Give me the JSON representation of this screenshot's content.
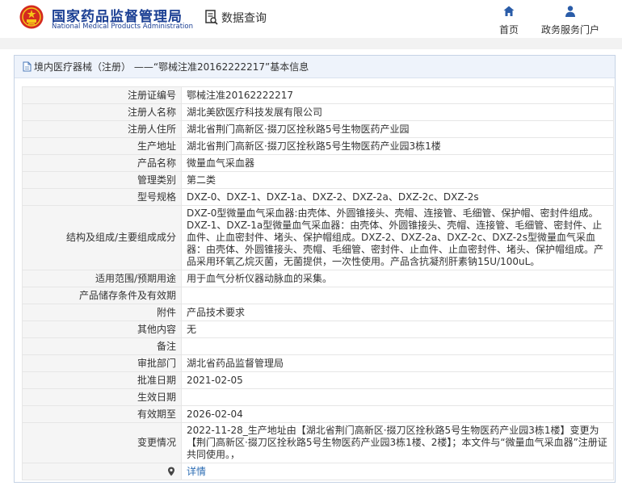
{
  "header": {
    "brand_cn": "国家药品监督管理局",
    "brand_en": "National Medical Products Administration",
    "search_label": "数据查询",
    "nav": [
      {
        "label": "首页",
        "icon": "home-icon"
      },
      {
        "label": "政务服务门户",
        "icon": "user-icon"
      }
    ]
  },
  "panel": {
    "title": "境内医疗器械（注册） ——“鄂械注准20162222217”基本信息"
  },
  "rows": [
    {
      "key": "注册证编号",
      "value": "鄂械注准20162222217"
    },
    {
      "key": "注册人名称",
      "value": "湖北美欧医疗科技发展有限公司"
    },
    {
      "key": "注册人住所",
      "value": "湖北省荆门高新区·掇刀区拴秋路5号生物医药产业园"
    },
    {
      "key": "生产地址",
      "value": "湖北省荆门高新区·掇刀区拴秋路5号生物医药产业园3栋1楼"
    },
    {
      "key": "产品名称",
      "value": "微量血气采血器"
    },
    {
      "key": "管理类别",
      "value": "第二类"
    },
    {
      "key": "型号规格",
      "value": "DXZ-0、DXZ-1、DXZ-1a、DXZ-2、DXZ-2a、DXZ-2c、DXZ-2s"
    },
    {
      "key": "结构及组成/主要组成成分",
      "value": "DXZ-0型微量血气采血器:由壳体、外圆锥接头、壳帽、连接管、毛细管、保护帽、密封件组成。DXZ-1、DXZ-1a型微量血气采血器：由壳体、外圆锥接头、壳帽、连接管、毛细管、密封件、止血件、止血密封件、堵头、保护帽组成。DXZ-2、DXZ-2a、DXZ-2c、DXZ-2s型微量血气采血器：由壳体、外圆锥接头、壳帽、毛细管、密封件、止血件、止血密封件、堵头、保护帽组成。产品采用环氧乙烷灭菌，无菌提供，一次性使用。产品含抗凝剂肝素钠15U/100uL。"
    },
    {
      "key": "适用范围/预期用途",
      "value": "用于血气分析仪器动脉血的采集。"
    },
    {
      "key": "产品储存条件及有效期",
      "value": ""
    },
    {
      "key": "附件",
      "value": "产品技术要求"
    },
    {
      "key": "其他内容",
      "value": "无"
    },
    {
      "key": "备注",
      "value": ""
    },
    {
      "key": "审批部门",
      "value": "湖北省药品监督管理局"
    },
    {
      "key": "批准日期",
      "value": "2021-02-05"
    },
    {
      "key": "生效日期",
      "value": ""
    },
    {
      "key": "有效期至",
      "value": "2026-02-04"
    },
    {
      "key": "变更情况",
      "value": "2022-11-28_生产地址由【湖北省荆门高新区·掇刀区拴秋路5号生物医药产业园3栋1楼】变更为【荆门高新区·掇刀区拴秋路5号生物医药产业园3栋1楼、2楼】；本文件与“微量血气采血器”注册证共同使用。，"
    },
    {
      "key": "",
      "value": "详情"
    }
  ]
}
